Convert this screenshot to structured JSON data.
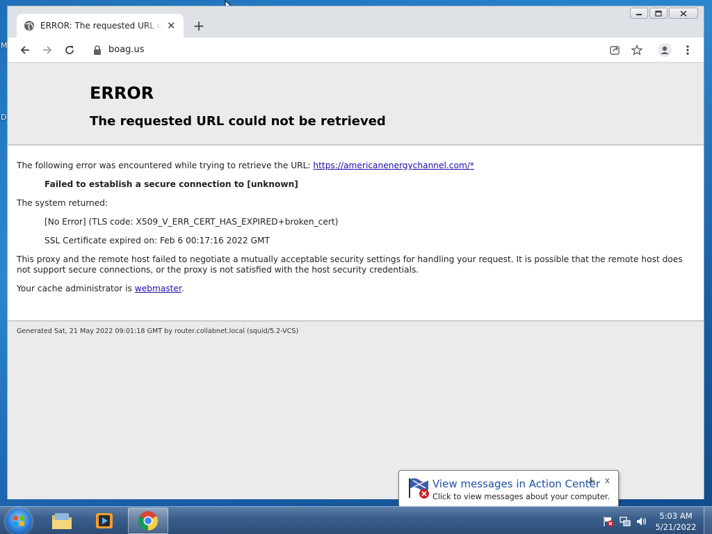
{
  "desktop": {
    "letters": [
      "M",
      "D"
    ]
  },
  "browser": {
    "tab_title": "ERROR: The requested URL could not be retrieved",
    "tab_close": "✕",
    "new_tab": "+",
    "url": "boag.us",
    "window_buttons": {
      "minimize": "▭",
      "maximize": "▣",
      "close": "✕"
    }
  },
  "page": {
    "title": "ERROR",
    "subtitle": "The requested URL could not be retrieved",
    "intro": "The following error was encountered while trying to retrieve the URL: ",
    "intro_link": "https://americanenergychannel.com/*",
    "failure": "Failed to establish a secure connection to [unknown]",
    "system_returned": "The system returned:",
    "no_error": "[No Error] (TLS code: X509_V_ERR_CERT_HAS_EXPIRED+broken_cert)",
    "ssl_expired": "SSL Certificate expired on: Feb 6 00:17:16 2022 GMT",
    "explanation": "This proxy and the remote host failed to negotiate a mutually acceptable security settings for handling your request. It is possible that the remote host does not support secure connections, or the proxy is not satisfied with the host security credentials.",
    "admin_prefix": "Your cache administrator is ",
    "admin_link": "webmaster",
    "admin_suffix": ".",
    "footer": "Generated Sat, 21 May 2022 09:01:18 GMT by router.collabnet.local (squid/5.2-VCS)"
  },
  "balloon": {
    "title": "View messages in Action Center",
    "text": "Click to view messages about your computer.",
    "close": "x"
  },
  "taskbar": {
    "time": "5:03 AM",
    "date": "5/21/2022"
  },
  "colors": {
    "link": "#1a0dab",
    "taskbar": "#3b5f8c",
    "balloon_title": "#1c4fa0"
  }
}
